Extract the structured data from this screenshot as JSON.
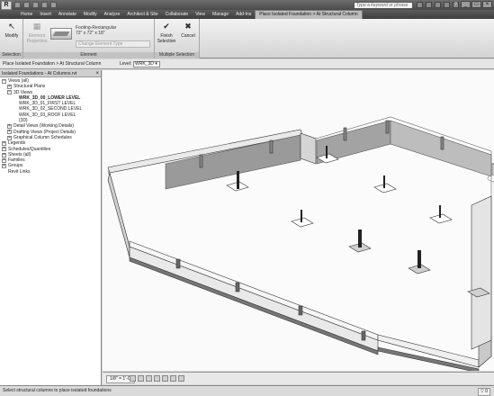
{
  "app": {
    "logo_letter": "R"
  },
  "search": {
    "placeholder": "Type a keyword or phrase"
  },
  "tabs": [
    {
      "label": "Home"
    },
    {
      "label": "Insert"
    },
    {
      "label": "Annotate"
    },
    {
      "label": "Modify"
    },
    {
      "label": "Analyze"
    },
    {
      "label": "Architect & Site"
    },
    {
      "label": "Collaborate"
    },
    {
      "label": "View"
    },
    {
      "label": "Manage"
    },
    {
      "label": "Add-Ins"
    },
    {
      "label": "Place Isolated Foundation > At Structural Column"
    }
  ],
  "ribbon": {
    "selection": {
      "title": "Selection",
      "modify_label": "Modify"
    },
    "element": {
      "title": "Element",
      "props_label": "Element Properties",
      "type_name_line1": "Footing-Rectangular",
      "type_name_line2": "72\" x 72\" x 18\"",
      "change_type": "Change Element Type"
    },
    "multiple": {
      "title": "Multiple Selection",
      "finish_label": "Finish Selection",
      "cancel_label": "Cancel"
    }
  },
  "options_bar": {
    "command": "Place Isolated Foundation > At Structural Column",
    "level_label": "Level:",
    "level_value": "WRK_3D"
  },
  "browser": {
    "title": "Isolated Foundations - At Columns.rvt",
    "tree": [
      {
        "label": "Views (all)",
        "pm": "−",
        "indent": 0
      },
      {
        "label": "Structural Plans",
        "pm": "+",
        "indent": 1
      },
      {
        "label": "3D Views",
        "pm": "−",
        "indent": 1
      },
      {
        "label": "WRK_3D_00_LOWER LEVEL",
        "pm": "",
        "indent": 2,
        "bold": true
      },
      {
        "label": "WRK_3D_01_FIRST LEVEL",
        "pm": "",
        "indent": 2
      },
      {
        "label": "WRK_3D_02_SECOND LEVEL",
        "pm": "",
        "indent": 2
      },
      {
        "label": "WRK_3D_03_ROOF LEVEL",
        "pm": "",
        "indent": 2
      },
      {
        "label": "{3D}",
        "pm": "",
        "indent": 2
      },
      {
        "label": "Detail Views (Working Details)",
        "pm": "+",
        "indent": 1
      },
      {
        "label": "Drafting Views (Project Details)",
        "pm": "+",
        "indent": 1
      },
      {
        "label": "Graphical Column Schedules",
        "pm": "+",
        "indent": 1
      },
      {
        "label": "Legends",
        "pm": "+",
        "indent": 0
      },
      {
        "label": "Schedules/Quantities",
        "pm": "+",
        "indent": 0
      },
      {
        "label": "Sheets (all)",
        "pm": "+",
        "indent": 0
      },
      {
        "label": "Families",
        "pm": "+",
        "indent": 0
      },
      {
        "label": "Groups",
        "pm": "+",
        "indent": 0
      },
      {
        "label": "Revit Links",
        "pm": "",
        "indent": 0
      }
    ]
  },
  "view_control": {
    "scale": "1/8\" = 1'-0\""
  },
  "status": {
    "message": "Select structural columns to place isolated foundations",
    "filter": "0"
  }
}
